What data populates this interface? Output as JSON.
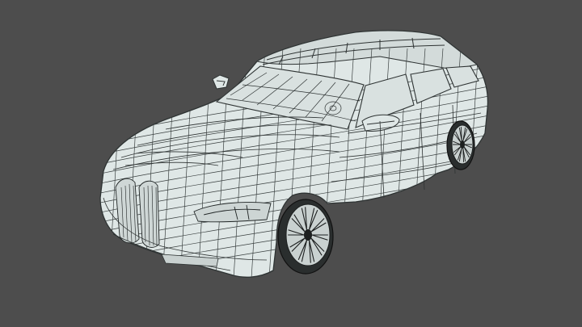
{
  "viewport": {
    "background_color": "#4d4d4d",
    "subject": "car-wireframe-model",
    "colors": {
      "surface": "#dfe7e6",
      "wire": "#2e3333",
      "wire_light": "#5f6767",
      "shadow_surface": "#c9d1d0",
      "wheel_dark": "#1c1f1f"
    }
  }
}
